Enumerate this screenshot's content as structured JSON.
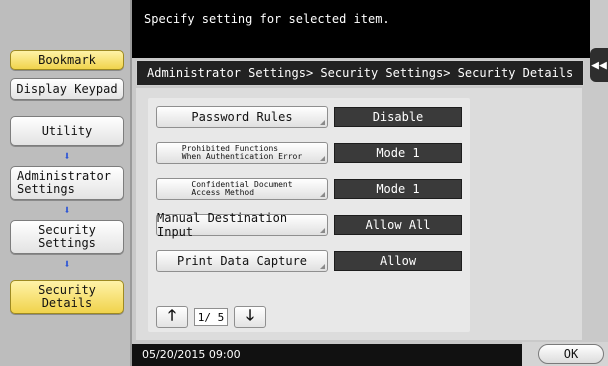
{
  "header": {
    "message": "Specify setting for selected item.",
    "collapse_icon": "double-chevron-left"
  },
  "sidebar": {
    "bookmark_label": "Bookmark",
    "display_keypad_label": "Display Keypad",
    "utility_label": "Utility",
    "admin_settings_label": "Administrator\nSettings",
    "security_settings_label": "Security\nSettings",
    "security_details_label": "Security Details",
    "arrow_icon": "arrow-down"
  },
  "breadcrumb": "Administrator Settings> Security Settings> Security Details",
  "settings": [
    {
      "label": "Password Rules",
      "value": "Disable"
    },
    {
      "label": "Prohibited Functions\nWhen Authentication Error",
      "value": "Mode 1"
    },
    {
      "label": "Confidential Document\nAccess Method",
      "value": "Mode 1"
    },
    {
      "label": "Manual Destination Input",
      "value": "Allow All"
    },
    {
      "label": "Print Data Capture",
      "value": "Allow"
    }
  ],
  "pager": {
    "page": "1/ 5",
    "up_symbol": "🡑",
    "down_symbol": "🡓"
  },
  "footer": {
    "datetime": "05/20/2015  09:00",
    "ok_label": "OK"
  },
  "colors": {
    "accent_yellow": "#f0d34c",
    "value_bg": "#3a3a3a",
    "arrow_blue": "#2b54d6"
  }
}
